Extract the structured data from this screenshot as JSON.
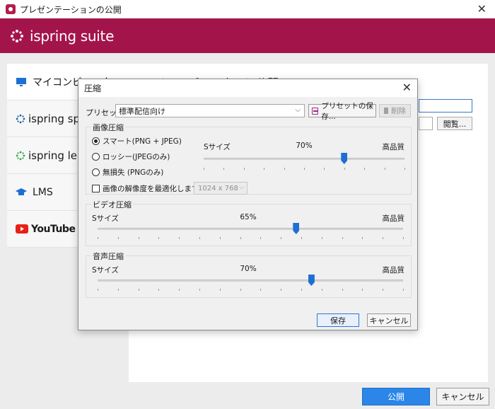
{
  "window": {
    "title": "プレゼンテーションの公開",
    "brand": "ispring suite",
    "colors": {
      "brand": "#a3154a",
      "primary": "#2b86e8"
    }
  },
  "sidebar": {
    "items": [
      {
        "label": "マイコンピューター",
        "icon": "monitor-icon"
      },
      {
        "label": "ispring space",
        "icon": "ispring-space-logo-icon"
      },
      {
        "label": "ispring learn",
        "icon": "ispring-learn-logo-icon"
      },
      {
        "label": "LMS",
        "icon": "graduation-cap-icon"
      },
      {
        "label": "YouTube",
        "icon": "youtube-logo-icon"
      }
    ]
  },
  "content": {
    "title": "マイコンピューターに公開",
    "browse_label": "閲覧..."
  },
  "footer": {
    "publish_label": "公開",
    "cancel_label": "キャンセル"
  },
  "dialog": {
    "title": "圧縮",
    "preset_label": "プリセット:",
    "preset_value": "標準配信向け",
    "save_preset_label": "プリセットの保存...",
    "delete_label": "削除",
    "image_group": {
      "title": "画像圧縮",
      "options": [
        "スマート(PNG + JPEG)",
        "ロッシー(JPEGのみ)",
        "無損失 (PNGのみ)"
      ],
      "selected": 0,
      "optimize_label": "画像の解像度を最適化します。",
      "optimize_checked": false,
      "resolution_value": "1024 x 768",
      "slider": {
        "min_label": "Sサイズ",
        "max_label": "高品質",
        "value": 70,
        "value_label": "70%"
      }
    },
    "video_group": {
      "title": "ビデオ圧縮",
      "slider": {
        "min_label": "Sサイズ",
        "max_label": "高品質",
        "value": 65,
        "value_label": "65%"
      }
    },
    "audio_group": {
      "title": "音声圧縮",
      "slider": {
        "min_label": "Sサイズ",
        "max_label": "高品質",
        "value": 70,
        "value_label": "70%"
      }
    },
    "save_label": "保存",
    "cancel_label": "キャンセル"
  }
}
